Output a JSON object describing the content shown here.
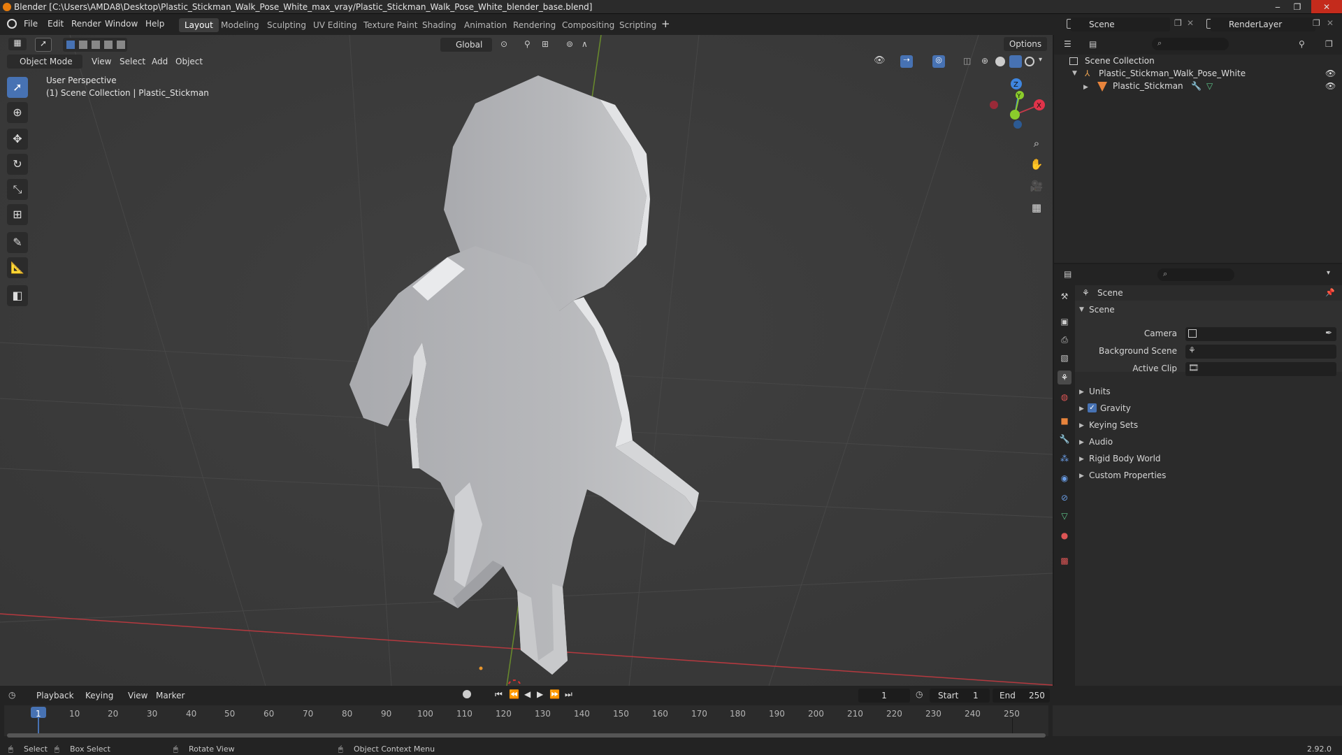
{
  "window": {
    "title": "Blender [C:\\Users\\AMDA8\\Desktop\\Plastic_Stickman_Walk_Pose_White_max_vray/Plastic_Stickman_Walk_Pose_White_blender_base.blend]",
    "minimize": "‒",
    "maximize": "❐",
    "close": "✕"
  },
  "menus": [
    "File",
    "Edit",
    "Render",
    "Window",
    "Help"
  ],
  "workspaces": [
    "Layout",
    "Modeling",
    "Sculpting",
    "UV Editing",
    "Texture Paint",
    "Shading",
    "Animation",
    "Rendering",
    "Compositing",
    "Scripting"
  ],
  "add_workspace": "+",
  "scene_selector": "Scene",
  "render_layer": "RenderLayer",
  "viewport": {
    "mode": "Object Mode",
    "header_menus": [
      "View",
      "Select",
      "Add",
      "Object"
    ],
    "transform_orientation": "Global",
    "options": "Options",
    "info_line1": "User Perspective",
    "info_line2": "(1) Scene Collection | Plastic_Stickman",
    "gizmo": {
      "x": "X",
      "y": "Y",
      "z": "Z"
    }
  },
  "outliner": {
    "root": "Scene Collection",
    "collection": "Plastic_Stickman_Walk_Pose_White",
    "object": "Plastic_Stickman"
  },
  "properties": {
    "header": "Scene",
    "panel": "Scene",
    "camera_label": "Camera",
    "background_scene_label": "Background Scene",
    "active_clip_label": "Active Clip",
    "subpanels": [
      "Units",
      "Gravity",
      "Keying Sets",
      "Audio",
      "Rigid Body World",
      "Custom Properties"
    ],
    "gravity_checked": true
  },
  "timeline": {
    "menus": [
      "Playback",
      "Keying",
      "View",
      "Marker"
    ],
    "current_frame": "1",
    "start_label": "Start",
    "start": "1",
    "end_label": "End",
    "end": "250",
    "ticks": [
      "1",
      "10",
      "20",
      "30",
      "40",
      "50",
      "60",
      "70",
      "80",
      "90",
      "100",
      "110",
      "120",
      "130",
      "140",
      "150",
      "160",
      "170",
      "180",
      "190",
      "200",
      "210",
      "220",
      "230",
      "240",
      "250"
    ]
  },
  "statusbar": {
    "select": "Select",
    "box_select": "Box Select",
    "rotate_view": "Rotate View",
    "context_menu": "Object Context Menu",
    "version": "2.92.0"
  },
  "colors": {
    "accent": "#4772b3",
    "x_axis": "#e0334a",
    "y_axis": "#8bcc2b",
    "z_axis": "#3f86e0",
    "model": "#b4b5b8"
  }
}
